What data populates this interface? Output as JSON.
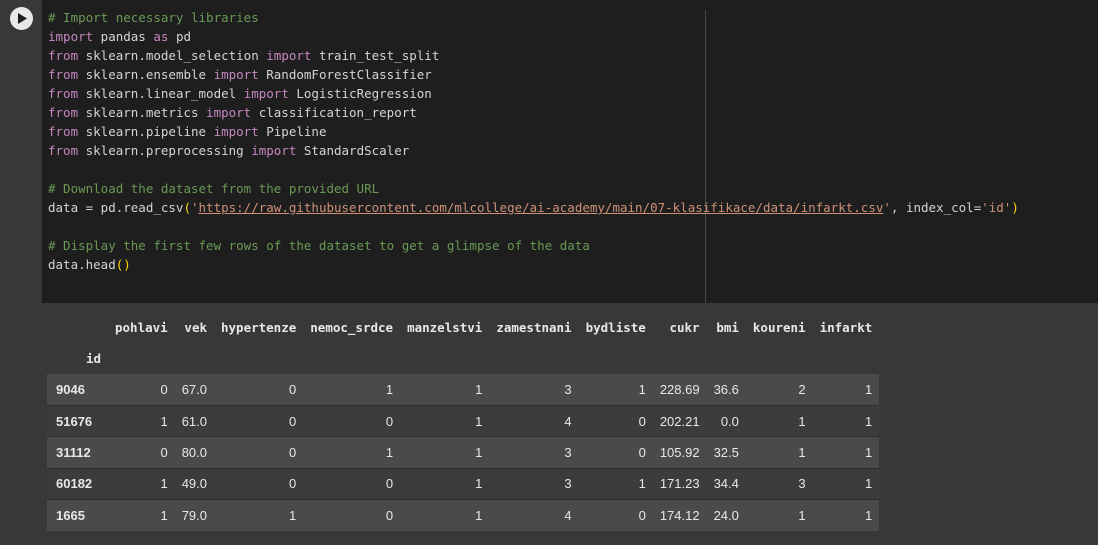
{
  "code_cell": {
    "run_button": "run-cell",
    "lines": [
      [
        {
          "t": "comment",
          "v": "# Import necessary libraries"
        }
      ],
      [
        {
          "t": "keyword",
          "v": "import"
        },
        {
          "t": "plain",
          "v": " pandas "
        },
        {
          "t": "keyword",
          "v": "as"
        },
        {
          "t": "plain",
          "v": " pd"
        }
      ],
      [
        {
          "t": "keyword",
          "v": "from"
        },
        {
          "t": "plain",
          "v": " sklearn.model_selection "
        },
        {
          "t": "keyword",
          "v": "import"
        },
        {
          "t": "plain",
          "v": " train_test_split"
        }
      ],
      [
        {
          "t": "keyword",
          "v": "from"
        },
        {
          "t": "plain",
          "v": " sklearn.ensemble "
        },
        {
          "t": "keyword",
          "v": "import"
        },
        {
          "t": "plain",
          "v": " RandomForestClassifier"
        }
      ],
      [
        {
          "t": "keyword",
          "v": "from"
        },
        {
          "t": "plain",
          "v": " sklearn.linear_model "
        },
        {
          "t": "keyword",
          "v": "import"
        },
        {
          "t": "plain",
          "v": " LogisticRegression"
        }
      ],
      [
        {
          "t": "keyword",
          "v": "from"
        },
        {
          "t": "plain",
          "v": " sklearn.metrics "
        },
        {
          "t": "keyword",
          "v": "import"
        },
        {
          "t": "plain",
          "v": " classification_report"
        }
      ],
      [
        {
          "t": "keyword",
          "v": "from"
        },
        {
          "t": "plain",
          "v": " sklearn.pipeline "
        },
        {
          "t": "keyword",
          "v": "import"
        },
        {
          "t": "plain",
          "v": " Pipeline"
        }
      ],
      [
        {
          "t": "keyword",
          "v": "from"
        },
        {
          "t": "plain",
          "v": " sklearn.preprocessing "
        },
        {
          "t": "keyword",
          "v": "import"
        },
        {
          "t": "plain",
          "v": " StandardScaler"
        }
      ],
      [],
      [
        {
          "t": "comment",
          "v": "# Download the dataset from the provided URL"
        }
      ],
      [
        {
          "t": "plain",
          "v": "data = pd.read_csv"
        },
        {
          "t": "paren",
          "v": "("
        },
        {
          "t": "string",
          "v": "'"
        },
        {
          "t": "url",
          "v": "https://raw.githubusercontent.com/mlcollege/ai-academy/main/07-klasifikace/data/infarkt.csv"
        },
        {
          "t": "string",
          "v": "'"
        },
        {
          "t": "plain",
          "v": ", index_col="
        },
        {
          "t": "string",
          "v": "'id'"
        },
        {
          "t": "paren",
          "v": ")"
        }
      ],
      [],
      [
        {
          "t": "comment",
          "v": "# Display the first few rows of the dataset to get a glimpse of the data"
        }
      ],
      [
        {
          "t": "plain",
          "v": "data.head"
        },
        {
          "t": "paren",
          "v": "()"
        }
      ]
    ]
  },
  "output": {
    "columns": [
      "pohlavi",
      "vek",
      "hypertenze",
      "nemoc_srdce",
      "manzelstvi",
      "zamestnani",
      "bydliste",
      "cukr",
      "bmi",
      "koureni",
      "infarkt"
    ],
    "index_name": "id",
    "rows": [
      {
        "id": "9046",
        "values": [
          "0",
          "67.0",
          "0",
          "1",
          "1",
          "3",
          "1",
          "228.69",
          "36.6",
          "2",
          "1"
        ]
      },
      {
        "id": "51676",
        "values": [
          "1",
          "61.0",
          "0",
          "0",
          "1",
          "4",
          "0",
          "202.21",
          "0.0",
          "1",
          "1"
        ]
      },
      {
        "id": "31112",
        "values": [
          "0",
          "80.0",
          "0",
          "1",
          "1",
          "3",
          "0",
          "105.92",
          "32.5",
          "1",
          "1"
        ]
      },
      {
        "id": "60182",
        "values": [
          "1",
          "49.0",
          "0",
          "0",
          "1",
          "3",
          "1",
          "171.23",
          "34.4",
          "3",
          "1"
        ]
      },
      {
        "id": "1665",
        "values": [
          "1",
          "79.0",
          "1",
          "0",
          "1",
          "4",
          "0",
          "174.12",
          "24.0",
          "1",
          "1"
        ]
      }
    ]
  }
}
